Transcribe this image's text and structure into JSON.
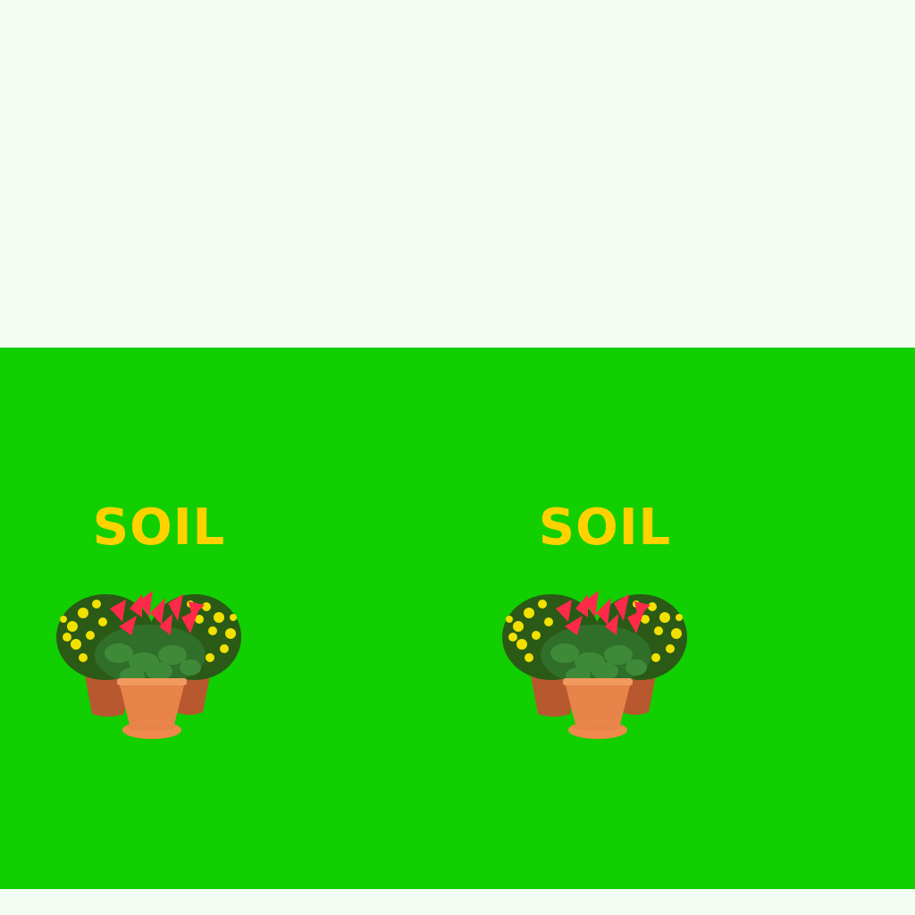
{
  "colors": {
    "background": "#f3fdf3",
    "field": "#11cf00",
    "label": "#ffd200",
    "pot": "#e8834a",
    "pot_dark": "#b8582e",
    "flower_red": "#ff2a4a",
    "flower_yellow": "#f2e000",
    "leaf": "#2f6f2a"
  },
  "slots": [
    {
      "label": "SOIL",
      "icon": "potted-flowers-icon"
    },
    {
      "label": "SOIL",
      "icon": "potted-flowers-icon"
    }
  ]
}
